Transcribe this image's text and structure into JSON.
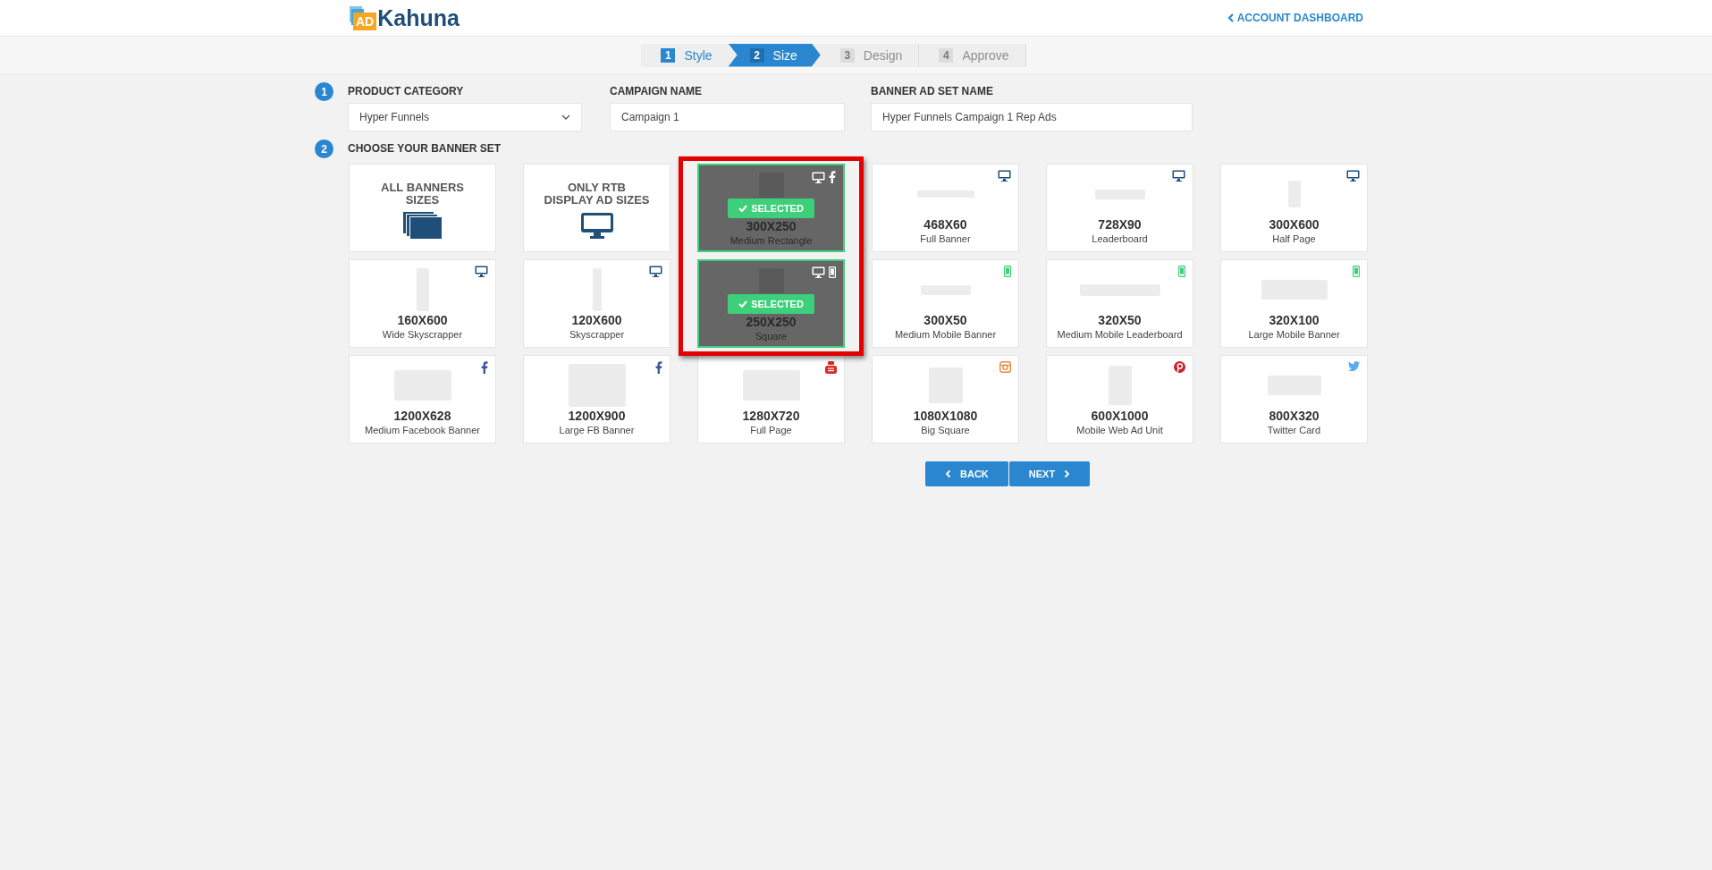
{
  "header": {
    "logo_badge": "AD",
    "logo_text": "Kahuna",
    "account_link": "ACCOUNT DASHBOARD"
  },
  "steps": [
    {
      "number": "1",
      "label": "Style",
      "selected": false,
      "disabled": false
    },
    {
      "number": "2",
      "label": "Size",
      "selected": true,
      "disabled": false
    },
    {
      "number": "3",
      "label": "Design",
      "selected": false,
      "disabled": true
    },
    {
      "number": "4",
      "label": "Approve",
      "selected": false,
      "disabled": true
    }
  ],
  "form": {
    "section_number": "1",
    "fields": [
      {
        "kind": "select",
        "label": "PRODUCT CATEGORY",
        "value": "Hyper Funnels"
      },
      {
        "kind": "text",
        "label": "CAMPAIGN NAME",
        "value": "Campaign 1"
      },
      {
        "kind": "text",
        "label": "BANNER AD SET NAME",
        "value": "Hyper Funnels Campaign 1 Rep Ads"
      }
    ]
  },
  "banner_set": {
    "section_number": "2",
    "title": "CHOOSE YOUR BANNER SET",
    "cards": [
      {
        "kind": "category",
        "title_lines": [
          "ALL BANNERS",
          "SIZES"
        ],
        "selected": false
      },
      {
        "kind": "category",
        "title_lines": [
          "ONLY RTB",
          "DISPLAY AD SIZES"
        ],
        "selected": false
      },
      {
        "kind": "size",
        "size": "300X250",
        "name": "Medium Rectangle",
        "platforms": [
          {
            "kind": "desktop"
          },
          {
            "kind": "facebook"
          }
        ],
        "selected": true,
        "badge": "SELECTED"
      },
      {
        "kind": "size",
        "size": "468X60",
        "name": "Full Banner",
        "platforms": [
          {
            "kind": "desktop"
          }
        ],
        "selected": false
      },
      {
        "kind": "size",
        "size": "728X90",
        "name": "Leaderboard",
        "platforms": [
          {
            "kind": "desktop"
          }
        ],
        "selected": false
      },
      {
        "kind": "size",
        "size": "300X600",
        "name": "Half Page",
        "platforms": [
          {
            "kind": "desktop"
          }
        ],
        "selected": false
      },
      {
        "kind": "size",
        "size": "160X600",
        "name": "Wide Skyscrapper",
        "platforms": [
          {
            "kind": "desktop"
          }
        ],
        "selected": false
      },
      {
        "kind": "size",
        "size": "120X600",
        "name": "Skyscrapper",
        "platforms": [
          {
            "kind": "desktop"
          }
        ],
        "selected": false
      },
      {
        "kind": "size",
        "size": "250X250",
        "name": "Square",
        "platforms": [
          {
            "kind": "desktop"
          },
          {
            "kind": "mobile"
          }
        ],
        "selected": true,
        "badge": "SELECTED"
      },
      {
        "kind": "size",
        "size": "300X50",
        "name": "Medium Mobile Banner",
        "platforms": [
          {
            "kind": "mobile"
          }
        ],
        "selected": false
      },
      {
        "kind": "size",
        "size": "320X50",
        "name": "Medium Mobile Leaderboard",
        "platforms": [
          {
            "kind": "mobile"
          }
        ],
        "selected": false
      },
      {
        "kind": "size",
        "size": "320X100",
        "name": "Large Mobile Banner",
        "platforms": [
          {
            "kind": "mobile"
          }
        ],
        "selected": false
      },
      {
        "kind": "size",
        "size": "1200X628",
        "name": "Medium Facebook Banner",
        "platforms": [
          {
            "kind": "facebook"
          }
        ],
        "selected": false
      },
      {
        "kind": "size",
        "size": "1200X900",
        "name": "Large FB Banner",
        "platforms": [
          {
            "kind": "facebook"
          }
        ],
        "selected": false
      },
      {
        "kind": "size",
        "size": "1280X720",
        "name": "Full Page",
        "platforms": [
          {
            "kind": "youtube"
          }
        ],
        "selected": false
      },
      {
        "kind": "size",
        "size": "1080X1080",
        "name": "Big Square",
        "platforms": [
          {
            "kind": "instagram"
          }
        ],
        "selected": false
      },
      {
        "kind": "size",
        "size": "600X1000",
        "name": "Mobile Web Ad Unit",
        "platforms": [
          {
            "kind": "pinterest"
          }
        ],
        "selected": false
      },
      {
        "kind": "size",
        "size": "800X320",
        "name": "Twitter Card",
        "platforms": [
          {
            "kind": "twitter"
          }
        ],
        "selected": false
      }
    ]
  },
  "navigation": {
    "back": "BACK",
    "next": "NEXT"
  }
}
